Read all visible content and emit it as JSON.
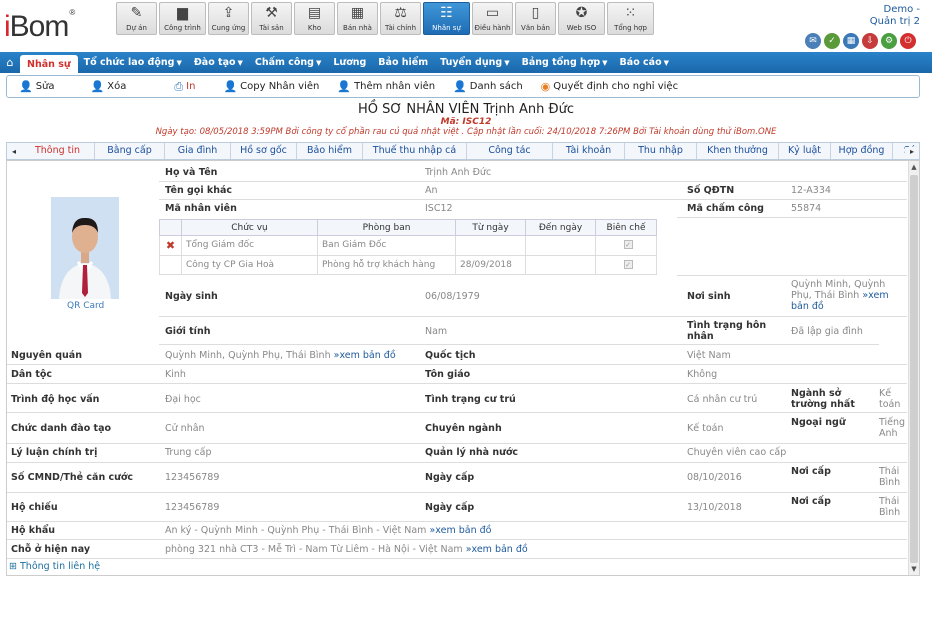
{
  "brand": {
    "logo": "iBom",
    "reg": "®"
  },
  "modules": [
    {
      "label": "Dự án",
      "icon": "project-icon",
      "glyph": "✎"
    },
    {
      "label": "Công trình",
      "icon": "construction-icon",
      "glyph": "▆"
    },
    {
      "label": "Cung ứng",
      "icon": "supply-icon",
      "glyph": "⇪"
    },
    {
      "label": "Tài sản",
      "icon": "asset-icon",
      "glyph": "⚒"
    },
    {
      "label": "Kho",
      "icon": "warehouse-icon",
      "glyph": "▤"
    },
    {
      "label": "Bán nhà",
      "icon": "house-sale-icon",
      "glyph": "▦"
    },
    {
      "label": "Tài chính",
      "icon": "finance-icon",
      "glyph": "⚖"
    },
    {
      "label": "Nhân sự",
      "icon": "hr-icon",
      "glyph": "☷"
    },
    {
      "label": "Điều hành",
      "icon": "monitor-icon",
      "glyph": "▭"
    },
    {
      "label": "Văn bản",
      "icon": "document-icon",
      "glyph": "▯"
    },
    {
      "label": "Web ISO",
      "icon": "iso-icon",
      "glyph": "✪"
    },
    {
      "label": "Tổng hợp",
      "icon": "grid-icon",
      "glyph": "⁙"
    }
  ],
  "user": {
    "name": "Demo -",
    "role": "Quản trị 2"
  },
  "menu": [
    {
      "label": "Nhân sự",
      "active": true
    },
    {
      "label": "Tổ chức lao động",
      "dd": true
    },
    {
      "label": "Đào tạo",
      "dd": true
    },
    {
      "label": "Chấm công",
      "dd": true
    },
    {
      "label": "Lương"
    },
    {
      "label": "Bảo hiểm"
    },
    {
      "label": "Tuyển dụng",
      "dd": true
    },
    {
      "label": "Bảng tổng hợp",
      "dd": true
    },
    {
      "label": "Báo cáo",
      "dd": true
    }
  ],
  "toolbar": {
    "edit": "Sửa",
    "delete": "Xóa",
    "print": "In",
    "copy": "Copy Nhân viên",
    "add": "Thêm nhân viên",
    "list": "Danh sách",
    "leave": "Quyết định cho nghỉ việc"
  },
  "header": {
    "title": "HỒ SƠ NHÂN VIÊN Trịnh Anh Đức",
    "code": "Mã: ISC12",
    "meta": "Ngày tạo: 08/05/2018 3:59PM Bởi công ty cổ phần rau củ quả nhật việt . Cập nhật lần cuối: 24/10/2018 7:26PM Bởi Tài khoản dùng thử iBom.ONE"
  },
  "tabs": [
    {
      "label": "Thông tin",
      "w": 74
    },
    {
      "label": "Bằng cấp",
      "w": 70
    },
    {
      "label": "Gia đình",
      "w": 66
    },
    {
      "label": "Hồ sơ gốc",
      "w": 66
    },
    {
      "label": "Bảo hiểm",
      "w": 66
    },
    {
      "label": "Thuế thu nhập cá nhân",
      "w": 104
    },
    {
      "label": "Công tác",
      "w": 86
    },
    {
      "label": "Tài khoản",
      "w": 72
    },
    {
      "label": "Thu nhập",
      "w": 72
    },
    {
      "label": "Khen thưởng",
      "w": 82
    },
    {
      "label": "Kỷ luật",
      "w": 52
    },
    {
      "label": "Hợp đồng",
      "w": 62
    },
    {
      "label": "Sức khỏe",
      "w": 40
    }
  ],
  "profile": {
    "qr": "QR Card",
    "full_name_lbl": "Họ và Tên",
    "full_name": "Trịnh Anh Đức",
    "nickname_lbl": "Tên gọi khác",
    "nickname": "An",
    "emp_code_lbl": "Mã nhân viên",
    "emp_code": "ISC12",
    "qdtn_lbl": "Số QĐTN",
    "qdtn": "12-A334",
    "att_lbl": "Mã chấm công",
    "att": "55874",
    "jobs_header": [
      "Chức vụ",
      "Phòng ban",
      "Từ ngày",
      "Đến ngày",
      "Biên chế"
    ],
    "jobs": [
      {
        "title": "Tổng Giám đốc",
        "dept": "Ban Giám Đốc",
        "from": "",
        "to": ""
      },
      {
        "title": "Công ty CP Gia Hoà",
        "dept": "Phòng hỗ trợ khách hàng",
        "from": "28/09/2018",
        "to": ""
      }
    ],
    "dob_lbl": "Ngày sinh",
    "dob": "06/08/1979",
    "pob_lbl": "Nơi sinh",
    "pob": "Quỳnh Minh, Quỳnh Phụ, Thái Bình",
    "map": "»xem bản đồ",
    "gender_lbl": "Giới tính",
    "gender": "Nam",
    "marital_lbl": "Tình trạng hôn nhân",
    "marital": "Đã lập gia đình",
    "hometown_lbl": "Nguyên quán",
    "hometown": "Quỳnh Minh, Quỳnh Phụ, Thái Bình",
    "nationality_lbl": "Quốc tịch",
    "nationality": "Việt Nam",
    "ethnic_lbl": "Dân tộc",
    "ethnic": "Kinh",
    "religion_lbl": "Tôn giáo",
    "religion": "Không",
    "edu_lbl": "Trình độ học vấn",
    "edu": "Đại học",
    "residence_lbl": "Tình trạng cư trú",
    "residence": "Cá nhân cư trú",
    "major_lbl": "Ngành sở trường nhất",
    "major": "Kế toán",
    "degree_lbl": "Chức danh đào tạo",
    "degree": "Cử nhân",
    "spec_lbl": "Chuyên ngành",
    "spec": "Kế toán",
    "lang_lbl": "Ngoại ngữ",
    "lang": "Tiếng Anh",
    "politics_lbl": "Lý luận chính trị",
    "politics": "Trung cấp",
    "mgmt_lbl": "Quản lý nhà nước",
    "mgmt": "Chuyên viên cao cấp",
    "id_lbl": "Số CMND/Thẻ căn cước",
    "id": "123456789",
    "id_date_lbl": "Ngày cấp",
    "id_date": "08/10/2016",
    "id_place_lbl": "Nơi cấp",
    "id_place": "Thái Bình",
    "passport_lbl": "Hộ chiếu",
    "passport": "123456789",
    "pp_date_lbl": "Ngày cấp",
    "pp_date": "13/10/2018",
    "pp_place_lbl": "Nơi cấp",
    "pp_place": "Thái Bình",
    "household_lbl": "Hộ khẩu",
    "household": "An ký - Quỳnh Minh - Quỳnh Phụ - Thái Bình - Việt Nam",
    "current_lbl": "Chỗ ở hiện nay",
    "current": "phòng 321 nhà CT3 - Mễ Trì - Nam Từ Liêm - Hà Nội - Việt Nam",
    "contact": "Thông tin liên hệ"
  }
}
